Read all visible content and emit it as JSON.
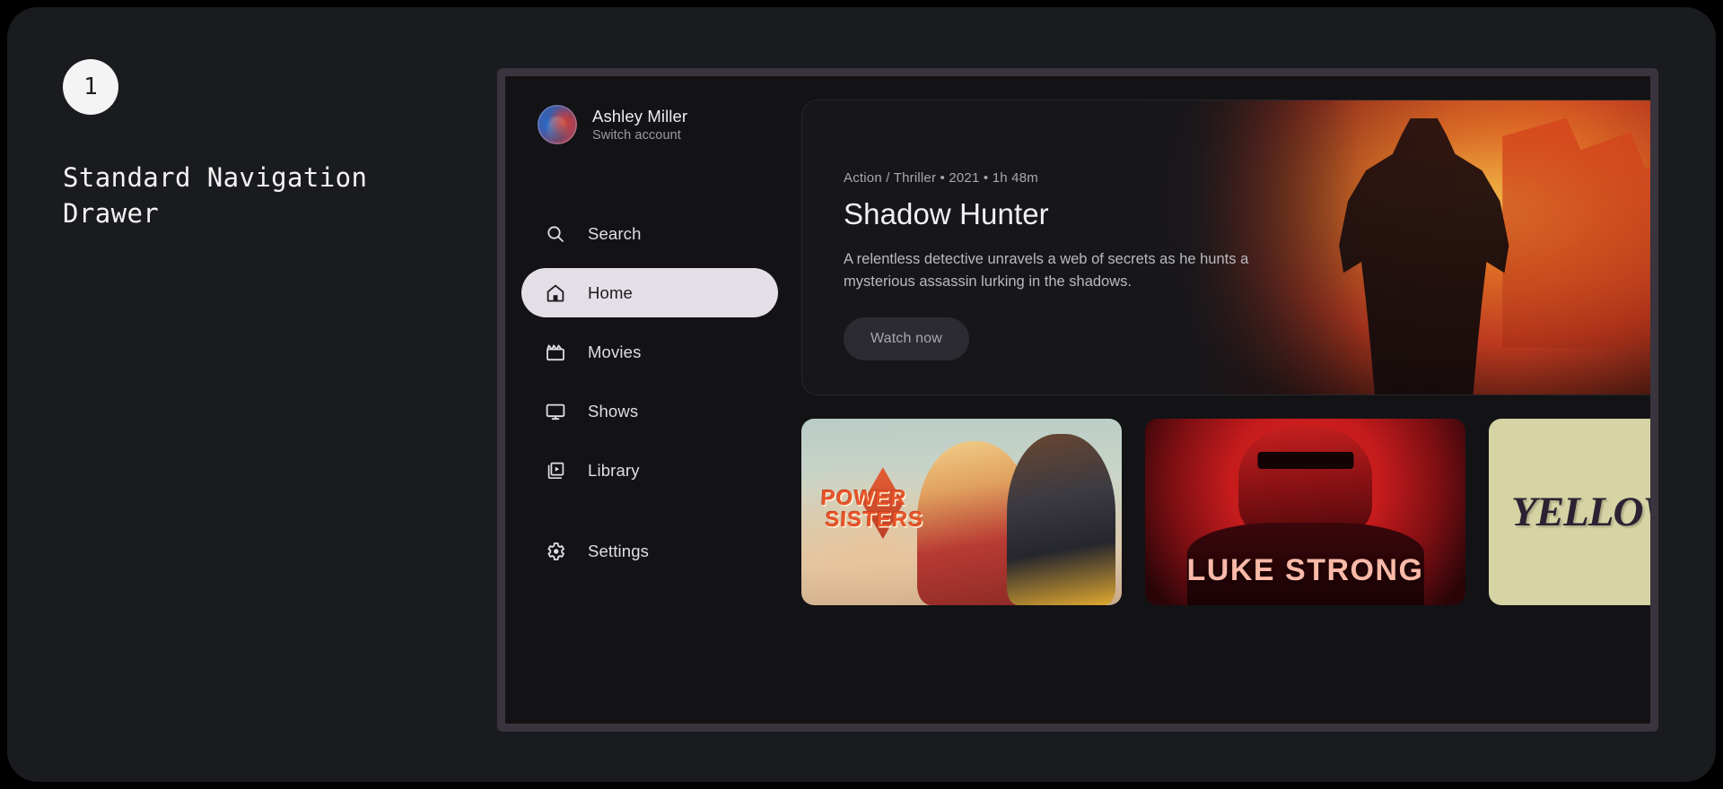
{
  "annotation": {
    "step_number": "1",
    "title": "Standard Navigation\nDrawer"
  },
  "drawer": {
    "account": {
      "name": "Ashley Miller",
      "switch_label": "Switch account",
      "avatar_icon": "user-avatar"
    },
    "items": [
      {
        "label": "Search",
        "icon": "search-icon",
        "selected": false,
        "name": "search"
      },
      {
        "label": "Home",
        "icon": "home-icon",
        "selected": true,
        "name": "home"
      },
      {
        "label": "Movies",
        "icon": "clapperboard-icon",
        "selected": false,
        "name": "movies"
      },
      {
        "label": "Shows",
        "icon": "monitor-icon",
        "selected": false,
        "name": "shows"
      },
      {
        "label": "Library",
        "icon": "video-library-icon",
        "selected": false,
        "name": "library"
      }
    ],
    "footer_item": {
      "label": "Settings",
      "icon": "gear-icon",
      "selected": false,
      "name": "settings"
    }
  },
  "hero": {
    "meta": "Action / Thriller • 2021 • 1h 48m",
    "title": "Shadow Hunter",
    "description": "A relentless detective unravels a web of secrets as he hunts a mysterious assassin lurking in the shadows.",
    "cta_label": "Watch now",
    "artwork_alt": "superhero-silhouette-artwork"
  },
  "cards": [
    {
      "title_line1": "POWER",
      "title_line2": "SISTERS",
      "artwork_alt": "power-sisters-poster"
    },
    {
      "title": "LUKE STRONG",
      "artwork_alt": "luke-strong-poster"
    },
    {
      "title": "YELLOW",
      "artwork_alt": "yellow-poster"
    }
  ],
  "colors": {
    "page_background": "#000000",
    "canvas_background": "#1a1b1e",
    "device_frame": "#39343d",
    "screen_background": "#131316",
    "selected_item": "#e4dfe7",
    "selected_item_text": "#1b1b1f",
    "primary_text": "#ececef",
    "secondary_text": "#9b9ba2",
    "cta_background": "#2b2b31"
  }
}
